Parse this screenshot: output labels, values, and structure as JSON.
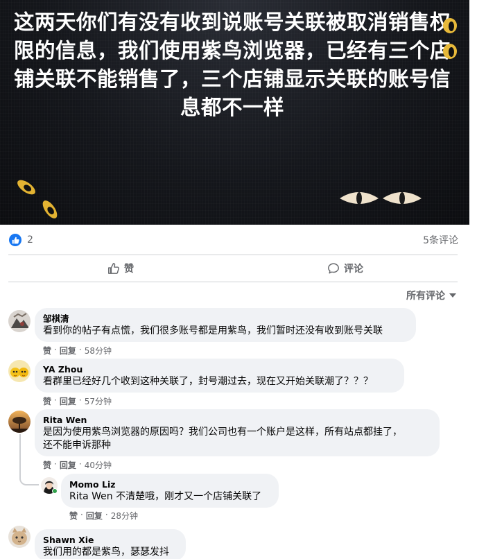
{
  "post_image": {
    "text": "这两天你们有没有收到说账号关联被取消销售权限的信息，我们使用紫鸟浏览器，已经有三个店铺关联不能销售了，三个店铺显示关联的账号信息都不一样"
  },
  "reactions": {
    "like_count": "2",
    "comment_count": "5条评论"
  },
  "actions": {
    "like_label": "赞",
    "comment_label": "评论"
  },
  "sort_label": "所有评论",
  "comments": [
    {
      "author": "邹棋清",
      "text": "看到你的帖子有点慌，我们很多账号都是用紫鸟，我们暂时还没有收到账号关联",
      "like": "赞",
      "reply": "回复",
      "time": "58分钟"
    },
    {
      "author": "YA Zhou",
      "text": "看群里已经好几个收到这种关联了，封号潮过去，现在又开始关联潮了？？？",
      "like": "赞",
      "reply": "回复",
      "time": "57分钟"
    },
    {
      "author": "Rita Wen",
      "text_line1": "是因为使用紫鸟浏览器的原因吗？我们公司也有一个账户是这样，所有站点都挂了，",
      "text_line2": "还不能申诉那种",
      "like": "赞",
      "reply": "回复",
      "time": "40分钟"
    },
    {
      "author": "Momo Liz",
      "mention": "Rita Wen",
      "text": " 不清楚哦，刚才又一个店铺关联了",
      "like": "赞",
      "reply": "回复",
      "time": "28分钟"
    },
    {
      "author": "Shawn Xie",
      "text": "我们用的都是紫鸟，瑟瑟发抖"
    }
  ],
  "colors": {
    "facebook_blue": "#1877f2",
    "bubble_bg": "#f0f2f5",
    "meta_gray": "#65676b"
  },
  "icons": {
    "like_badge": "thumbs-up-icon",
    "like_action": "thumbs-up-outline-icon",
    "comment_action": "speech-bubble-icon",
    "sort": "caret-down-icon"
  }
}
